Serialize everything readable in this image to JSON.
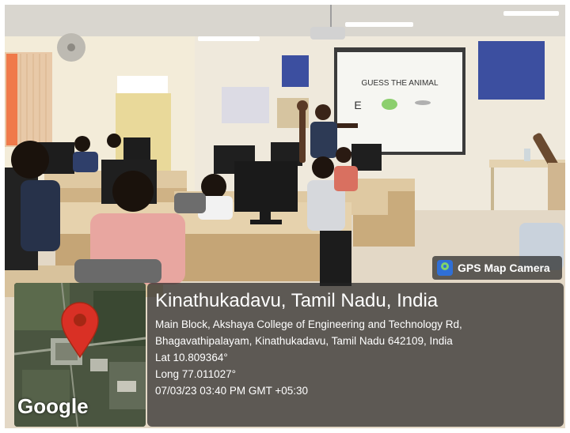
{
  "screen": {
    "projector_text": "GUESS THE ANIMAL",
    "projector_letter": "E"
  },
  "watermark": {
    "app_name": "GPS Map Camera",
    "icon": "gps-map-camera-icon"
  },
  "map": {
    "provider_logo": "Google",
    "marker_icon": "location-pin-icon",
    "marker_color": "#d93025"
  },
  "location": {
    "title": "Kinathukadavu, Tamil Nadu, India",
    "address_line1": "Main Block, Akshaya College of Engineering and Technology Rd,",
    "address_line2": "Bhagavathipalayam, Kinathukadavu, Tamil Nadu 642109, India",
    "latitude": "Lat 10.809364°",
    "longitude": "Long 77.011027°",
    "timestamp": "07/03/23 03:40 PM GMT +05:30"
  }
}
